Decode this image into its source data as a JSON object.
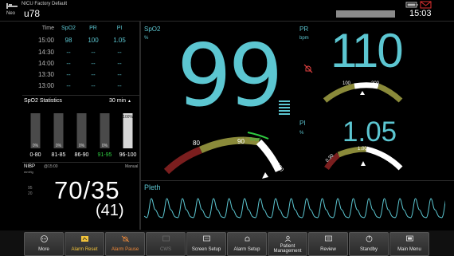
{
  "header": {
    "title": "NICU Factory Default",
    "patient_mode": "Neo",
    "bed": "u78",
    "time": "15:03",
    "icons": [
      "bed-icon",
      "battery-icon",
      "mail-icon"
    ]
  },
  "trend_table": {
    "headers": [
      "Time",
      "SpO2",
      "PR",
      "PI"
    ],
    "rows": [
      {
        "time": "15:00",
        "spo2": "98",
        "pr": "100",
        "pi": "1.05"
      },
      {
        "time": "14:30",
        "spo2": "--",
        "pr": "--",
        "pi": "--"
      },
      {
        "time": "14:00",
        "spo2": "--",
        "pr": "--",
        "pi": "--"
      },
      {
        "time": "13:30",
        "spo2": "--",
        "pr": "--",
        "pi": "--"
      },
      {
        "time": "13:00",
        "spo2": "--",
        "pr": "--",
        "pi": "--"
      }
    ]
  },
  "spo2_stats": {
    "title": "SpO2 Statistics",
    "period": "30 min",
    "chart_data": {
      "type": "bar",
      "categories": [
        "0-80",
        "81-85",
        "86-90",
        "91-95",
        "96-100"
      ],
      "values": [
        0,
        0,
        0,
        0,
        100
      ],
      "labels": [
        "0%",
        "0%",
        "0%",
        "0%",
        "100%"
      ],
      "ylim": [
        0,
        100
      ],
      "highlight_color": "#2ecc40"
    }
  },
  "nibp": {
    "label": "NIBP",
    "unit": "mmHg",
    "time": "@15:00",
    "mode": "Manual",
    "limit_high": "95",
    "limit_low": "20",
    "value": "70/35",
    "mean": "(41)"
  },
  "spo2": {
    "label": "SpO2",
    "unit": "%",
    "value": "99",
    "gauge_ticks": [
      "80",
      "90",
      "100"
    ],
    "target_label": "Target"
  },
  "pr": {
    "label": "PR",
    "unit": "bpm",
    "value": "110",
    "gauge_ticks": [
      "100",
      "200"
    ]
  },
  "pi": {
    "label": "PI",
    "unit": "%",
    "value": "1.05",
    "gauge_ticks": [
      "0.30",
      "1.00"
    ]
  },
  "pleth": {
    "label": "Pleth"
  },
  "bottom_bar": [
    {
      "label": "More",
      "icon": "more-icon",
      "style": "normal"
    },
    {
      "label": "Alarm Reset",
      "icon": "alarm-reset-icon",
      "style": "amber"
    },
    {
      "label": "Alarm Pause",
      "icon": "alarm-pause-icon",
      "style": "orange"
    },
    {
      "label": "CWS",
      "icon": "cws-icon",
      "style": "disabled"
    },
    {
      "label": "Screen Setup",
      "icon": "screen-setup-icon",
      "style": "normal"
    },
    {
      "label": "Alarm Setup",
      "icon": "alarm-setup-icon",
      "style": "normal"
    },
    {
      "label": "Patient Management",
      "icon": "patient-icon",
      "style": "normal"
    },
    {
      "label": "Review",
      "icon": "review-icon",
      "style": "normal"
    },
    {
      "label": "Standby",
      "icon": "standby-icon",
      "style": "normal"
    },
    {
      "label": "Main Menu",
      "icon": "main-menu-icon",
      "style": "normal"
    }
  ],
  "colors": {
    "parameter": "#5cc6d1",
    "gauge_low": "#7a1e1e",
    "gauge_mid": "#8a8a3a",
    "gauge_high": "#ffffff",
    "target": "#2ecc40"
  }
}
